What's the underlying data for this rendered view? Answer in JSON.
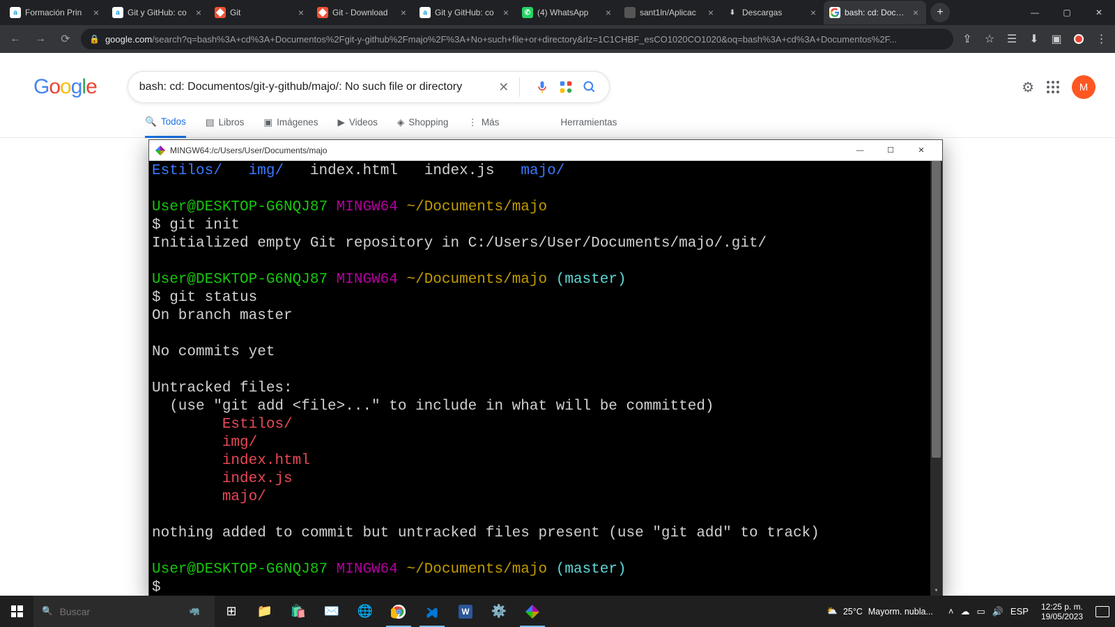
{
  "browser": {
    "tabs": [
      {
        "title": "Formación Prin",
        "favicon_type": "a"
      },
      {
        "title": "Git y GitHub: co",
        "favicon_type": "a"
      },
      {
        "title": "Git",
        "favicon_type": "git"
      },
      {
        "title": "Git - Download",
        "favicon_type": "git"
      },
      {
        "title": "Git y GitHub: co",
        "favicon_type": "a"
      },
      {
        "title": "(4) WhatsApp",
        "favicon_type": "wa"
      },
      {
        "title": "sant1ln/Aplicac",
        "favicon_type": "blank"
      },
      {
        "title": "Descargas",
        "favicon_type": "dl"
      },
      {
        "title": "bash: cd: Docum",
        "favicon_type": "g",
        "active": true
      }
    ],
    "url_host": "google.com",
    "url_path": "/search?q=bash%3A+cd%3A+Documentos%2Fgit-y-github%2Fmajo%2F%3A+No+such+file+or+directory&rlz=1C1CHBF_esCO1020CO1020&oq=bash%3A+cd%3A+Documentos%2F..."
  },
  "google": {
    "query": "bash: cd: Documentos/git-y-github/majo/: No such file or directory",
    "tabs": {
      "todos": "Todos",
      "libros": "Libros",
      "imagenes": "Imágenes",
      "videos": "Videos",
      "shopping": "Shopping",
      "mas": "Más",
      "herramientas": "Herramientas"
    },
    "avatar_letter": "M"
  },
  "terminal": {
    "title": "MINGW64:/c/Users/User/Documents/majo",
    "ls_line": {
      "dir1": "Estilos/",
      "dir2": "img/",
      "f1": "index.html",
      "f2": "index.js",
      "dir3": "majo/"
    },
    "prompt": {
      "user": "User@DESKTOP-G6NQJ87",
      "shell": "MINGW64",
      "path": "~/Documents/majo",
      "branch": "(master)"
    },
    "cmd_init": "$ git init",
    "out_init": "Initialized empty Git repository in C:/Users/User/Documents/majo/.git/",
    "cmd_status": "$ git status",
    "status_branch": "On branch master",
    "status_nocommits": "No commits yet",
    "status_untracked_hdr": "Untracked files:",
    "status_untracked_hint": "  (use \"git add <file>...\" to include in what will be committed)",
    "untracked": [
      "Estilos/",
      "img/",
      "index.html",
      "index.js",
      "majo/"
    ],
    "status_footer": "nothing added to commit but untracked files present (use \"git add\" to track)",
    "prompt_empty": "$"
  },
  "taskbar": {
    "search_placeholder": "Buscar",
    "weather_temp": "25°C",
    "weather_text": "Mayorm. nubla...",
    "lang": "ESP",
    "time": "12:25 p. m.",
    "date": "19/05/2023"
  }
}
